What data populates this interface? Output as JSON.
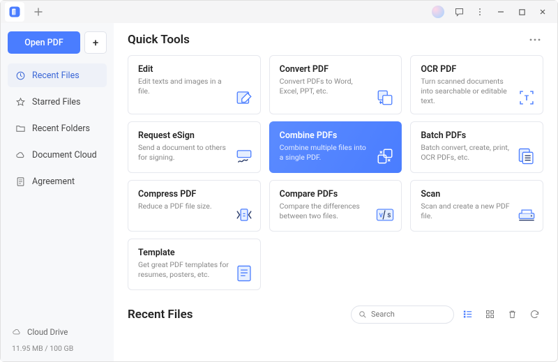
{
  "sidebar": {
    "open_label": "Open PDF",
    "items": [
      {
        "label": "Recent Files"
      },
      {
        "label": "Starred Files"
      },
      {
        "label": "Recent Folders"
      },
      {
        "label": "Document Cloud"
      },
      {
        "label": "Agreement"
      }
    ],
    "cloud_label": "Cloud Drive",
    "storage_text": "11.95 MB / 100 GB"
  },
  "quick_tools": {
    "heading": "Quick Tools",
    "cards": {
      "edit": {
        "title": "Edit",
        "desc": "Edit texts and images in a file."
      },
      "convert": {
        "title": "Convert PDF",
        "desc": "Convert PDFs to Word, Excel, PPT, etc."
      },
      "ocr": {
        "title": "OCR PDF",
        "desc": "Turn scanned documents into searchable or editable text."
      },
      "esign": {
        "title": "Request eSign",
        "desc": "Send a document to others for signing."
      },
      "combine": {
        "title": "Combine PDFs",
        "desc": "Combine multiple files into a single PDF."
      },
      "batch": {
        "title": "Batch PDFs",
        "desc": "Batch convert, create, print, OCR PDFs, etc."
      },
      "compress": {
        "title": "Compress PDF",
        "desc": "Reduce a PDF file size."
      },
      "compare": {
        "title": "Compare PDFs",
        "desc": "Compare the differences between two files."
      },
      "scan": {
        "title": "Scan",
        "desc": "Scan and create a new PDF file."
      },
      "template": {
        "title": "Template",
        "desc": "Get great PDF templates for resumes, posters, etc."
      }
    }
  },
  "recent_files": {
    "heading": "Recent Files",
    "search_placeholder": "Search"
  }
}
